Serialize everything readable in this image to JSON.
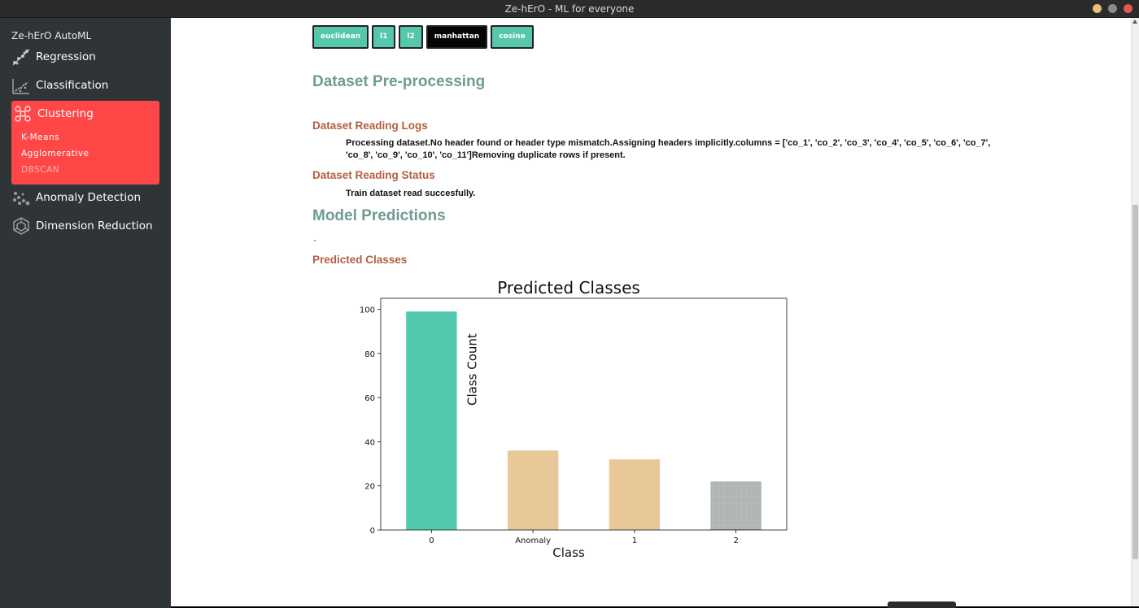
{
  "window": {
    "title": "Ze-hErO - ML for everyone",
    "btn_colors": [
      "#e8c07a",
      "#8a8a8a",
      "#e05a4f"
    ]
  },
  "sidebar": {
    "brand": "Ze-hErO AutoML",
    "items": [
      {
        "label": "Regression",
        "icon": "regression-icon"
      },
      {
        "label": "Classification",
        "icon": "classification-icon"
      },
      {
        "label": "Clustering",
        "icon": "clustering-icon",
        "active": true,
        "subitems": [
          "K-Means",
          "Agglomerative",
          "DBSCAN"
        ]
      },
      {
        "label": "Anomaly Detection",
        "icon": "anomaly-icon"
      },
      {
        "label": "Dimension Reduction",
        "icon": "dimension-icon"
      }
    ],
    "active_color": "#ff4747"
  },
  "metrics": {
    "buttons": [
      "euclidean",
      "l1",
      "l2",
      "manhattan",
      "cosine"
    ],
    "selected": "manhattan"
  },
  "content": {
    "preprocess_heading": "Dataset Pre-processing",
    "logs_heading": "Dataset Reading Logs",
    "logs_text": "Processing dataset.No header found or header type mismatch.Assigning headers implicitly.columns = ['co_1', 'co_2', 'co_3', 'co_4', 'co_5', 'co_6', 'co_7', 'co_8', 'co_9', 'co_10', 'co_11']Removing duplicate rows if present.",
    "status_heading": "Dataset Reading Status",
    "status_text": "Train dataset read succesfully.",
    "predictions_heading": "Model Predictions",
    "predicted_classes_heading": "Predicted Classes"
  },
  "chart_data": {
    "type": "bar",
    "title": "Predicted Classes",
    "xlabel": "Class",
    "ylabel": "Class Count",
    "categories": [
      "0",
      "Anomaly",
      "1",
      "2"
    ],
    "values": [
      99,
      36,
      32,
      22
    ],
    "colors": [
      "#52c9af",
      "#e8c898",
      "#e8c898",
      "#b8bcbc"
    ],
    "ylim": [
      0,
      105
    ],
    "yticks": [
      0,
      20,
      40,
      60,
      80,
      100
    ]
  }
}
